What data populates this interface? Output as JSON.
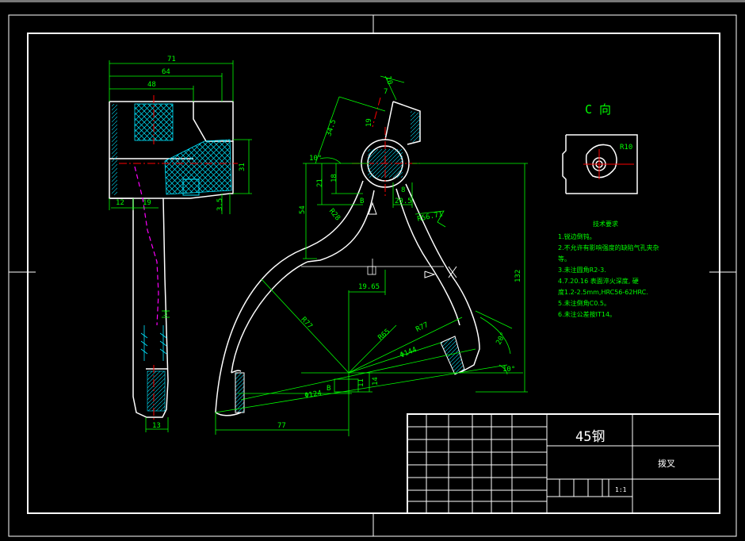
{
  "colors": {
    "background": "#000000",
    "outline": "#ffffff",
    "dimension": "#00ff00",
    "centerline": "#ff0000",
    "hidden": "#ff00ff",
    "hatch": "#00e5ff"
  },
  "dims": {
    "d71": "71",
    "d64": "64",
    "d48": "48",
    "d31": "31",
    "d12": "12",
    "d19a": "19",
    "d35": "3.5",
    "d3": "3",
    "d13": "13",
    "d10a": "10",
    "d7": "7",
    "d345": "34.5",
    "d19b": "19",
    "d10b": "10°",
    "d21": "21",
    "d18": "18",
    "d54": "54",
    "dr28": "R28",
    "dB1": "B",
    "d8": "8",
    "d205": "20.5",
    "dr5671": "R56.71",
    "d1965": "19.65",
    "d132": "132",
    "dr77a": "R77",
    "dr65": "R65",
    "dr77b": "R77",
    "dphi144": "Φ144",
    "dphi124": "Φ124",
    "dB2": "B",
    "d11": "11",
    "d14": "14",
    "d77": "77",
    "d20deg": "20°",
    "d10deg": "10°"
  },
  "view_c": {
    "title": "C 向",
    "radius": "R10"
  },
  "notes": {
    "heading": "技术要求",
    "items": [
      "1.锐边倒钝。",
      "2.不允许有影响强度的缺陷气孔夹杂",
      "等。",
      "3.未注圆角R2-3.",
      "4.7.20.16 表面淬火深度, 硬",
      "度1.2-2.5mm,HRC56-62HRC.",
      "5.未注倒角C0.5。",
      "6.未注公差按IT14。"
    ]
  },
  "title_block": {
    "material": "45钢",
    "name": "拨叉",
    "scale": "1:1"
  }
}
